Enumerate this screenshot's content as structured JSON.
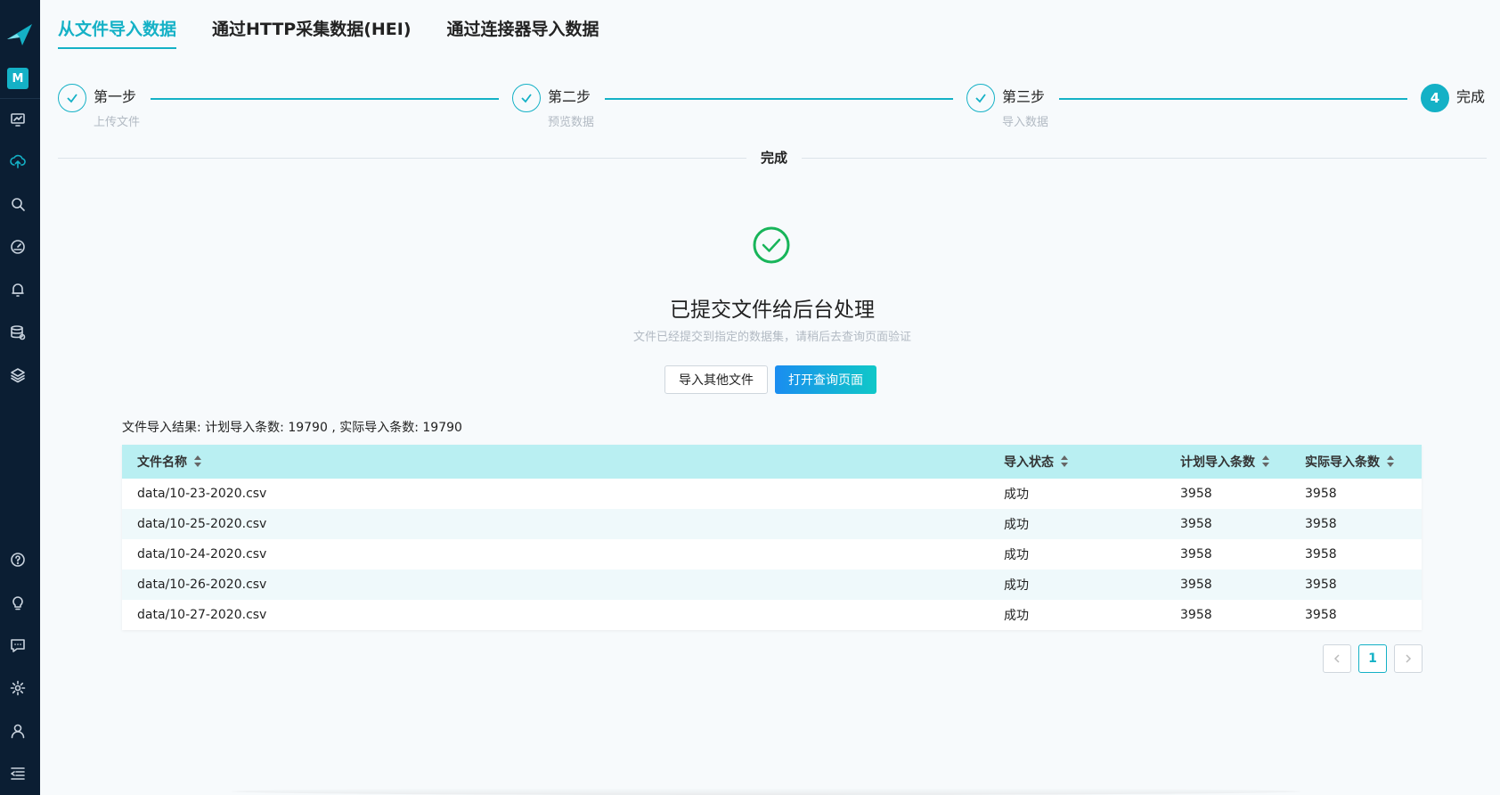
{
  "sidebar": {
    "avatar_letter": "M",
    "top_icons": [
      "dashboard-icon",
      "cloud-upload-icon",
      "search-icon",
      "gauge-icon",
      "bell-icon",
      "database-icon",
      "layers-icon"
    ],
    "bottom_icons": [
      "help-icon",
      "lightbulb-icon",
      "feedback-icon",
      "settings-icon",
      "user-icon",
      "menu-collapse-icon"
    ],
    "active_icon": "cloud-upload-icon"
  },
  "tabs": [
    {
      "label": "从文件导入数据",
      "active": true
    },
    {
      "label": "通过HTTP采集数据(HEI)",
      "active": false
    },
    {
      "label": "通过连接器导入数据",
      "active": false
    }
  ],
  "steps": [
    {
      "title": "第一步",
      "desc": "上传文件",
      "status": "done"
    },
    {
      "title": "第二步",
      "desc": "预览数据",
      "status": "done"
    },
    {
      "title": "第三步",
      "desc": "导入数据",
      "status": "done"
    },
    {
      "number": "4",
      "title": "完成",
      "status": "current"
    }
  ],
  "divider_label": "完成",
  "result": {
    "title": "已提交文件给后台处理",
    "subtitle": "文件已经提交到指定的数据集，请稍后去查询页面验证",
    "btn_other": "导入其他文件",
    "btn_open": "打开查询页面"
  },
  "summary": "文件导入结果: 计划导入条数: 19790 , 实际导入条数: 19790",
  "table": {
    "headers": [
      "文件名称",
      "导入状态",
      "计划导入条数",
      "实际导入条数"
    ],
    "rows": [
      [
        "data/10-23-2020.csv",
        "成功",
        "3958",
        "3958"
      ],
      [
        "data/10-25-2020.csv",
        "成功",
        "3958",
        "3958"
      ],
      [
        "data/10-24-2020.csv",
        "成功",
        "3958",
        "3958"
      ],
      [
        "data/10-26-2020.csv",
        "成功",
        "3958",
        "3958"
      ],
      [
        "data/10-27-2020.csv",
        "成功",
        "3958",
        "3958"
      ]
    ]
  },
  "pagination": {
    "current": "1"
  },
  "colors": {
    "accent": "#14b1c6",
    "success": "#18b55a",
    "sidebar": "#0b1e33",
    "table_header": "#b9eff2"
  }
}
